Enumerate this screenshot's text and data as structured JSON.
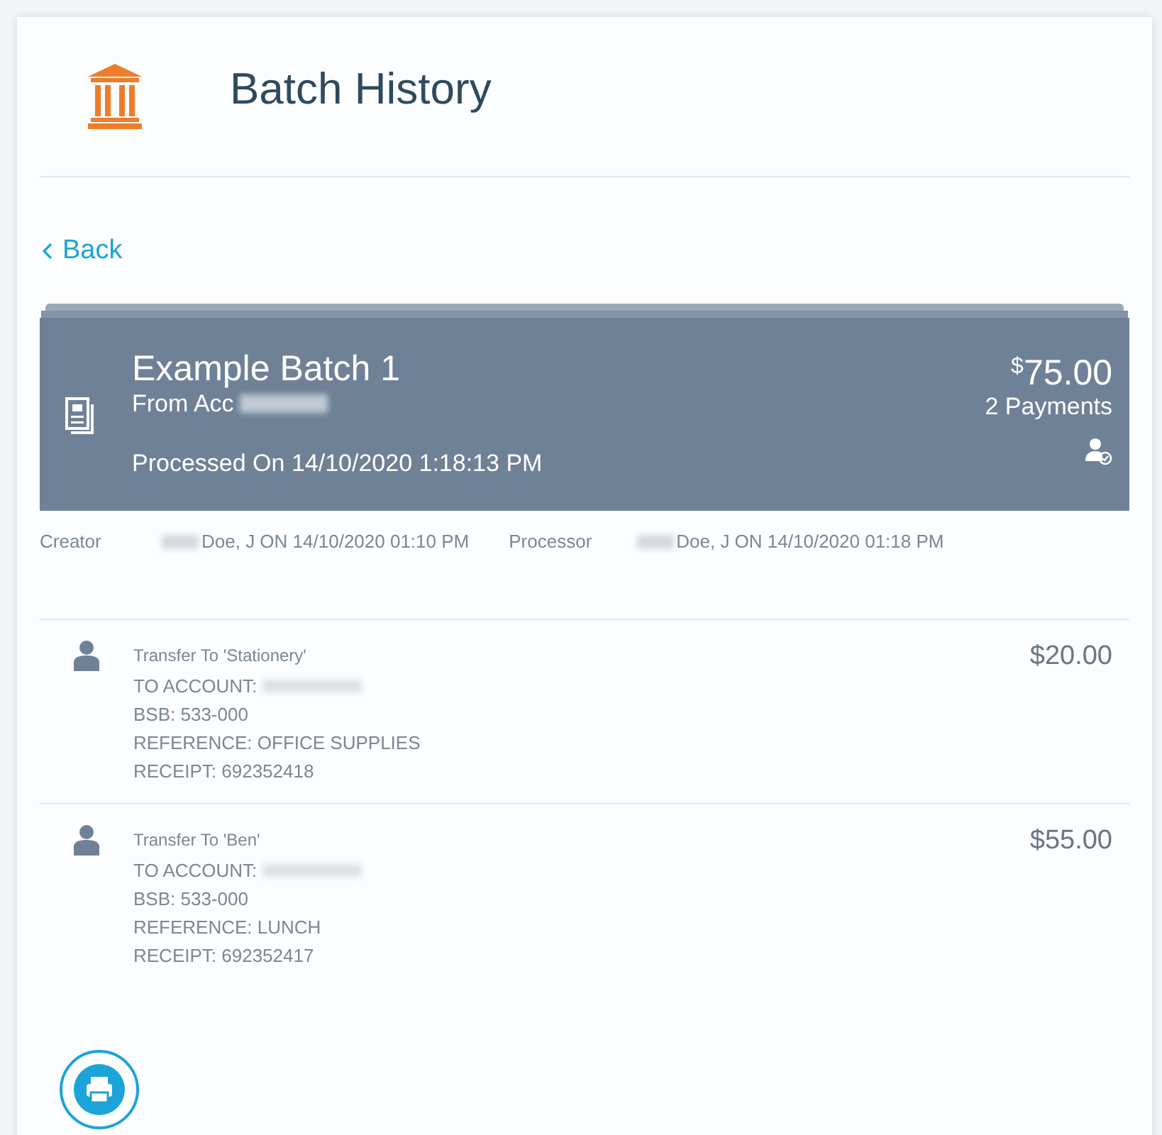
{
  "header": {
    "title": "Batch History"
  },
  "back_link": {
    "label": "Back"
  },
  "batch": {
    "name": "Example Batch 1",
    "from_account": "From Acc",
    "processed": "Processed On 14/10/2020 1:18:13 PM",
    "currency": "$",
    "amount": "75.00",
    "payments": "2 Payments"
  },
  "audit": [
    {
      "label": "Creator",
      "value": "Doe, J ON 14/10/2020 01:10 PM"
    },
    {
      "label": "Processor",
      "value": "Doe, J ON 14/10/2020 01:18 PM"
    }
  ],
  "payments": [
    {
      "title": "Transfer To 'Stationery'",
      "account": "TO ACCOUNT:",
      "bsb": "BSB: 533-000",
      "reference": "REFERENCE: OFFICE SUPPLIES",
      "receipt": "RECEIPT: 692352418",
      "amount": "$20.00"
    },
    {
      "title": "Transfer To 'Ben'",
      "account": "TO ACCOUNT:",
      "bsb": "BSB: 533-000",
      "reference": "REFERENCE: LUNCH",
      "receipt": "RECEIPT: 692352417",
      "amount": "$55.00"
    }
  ]
}
